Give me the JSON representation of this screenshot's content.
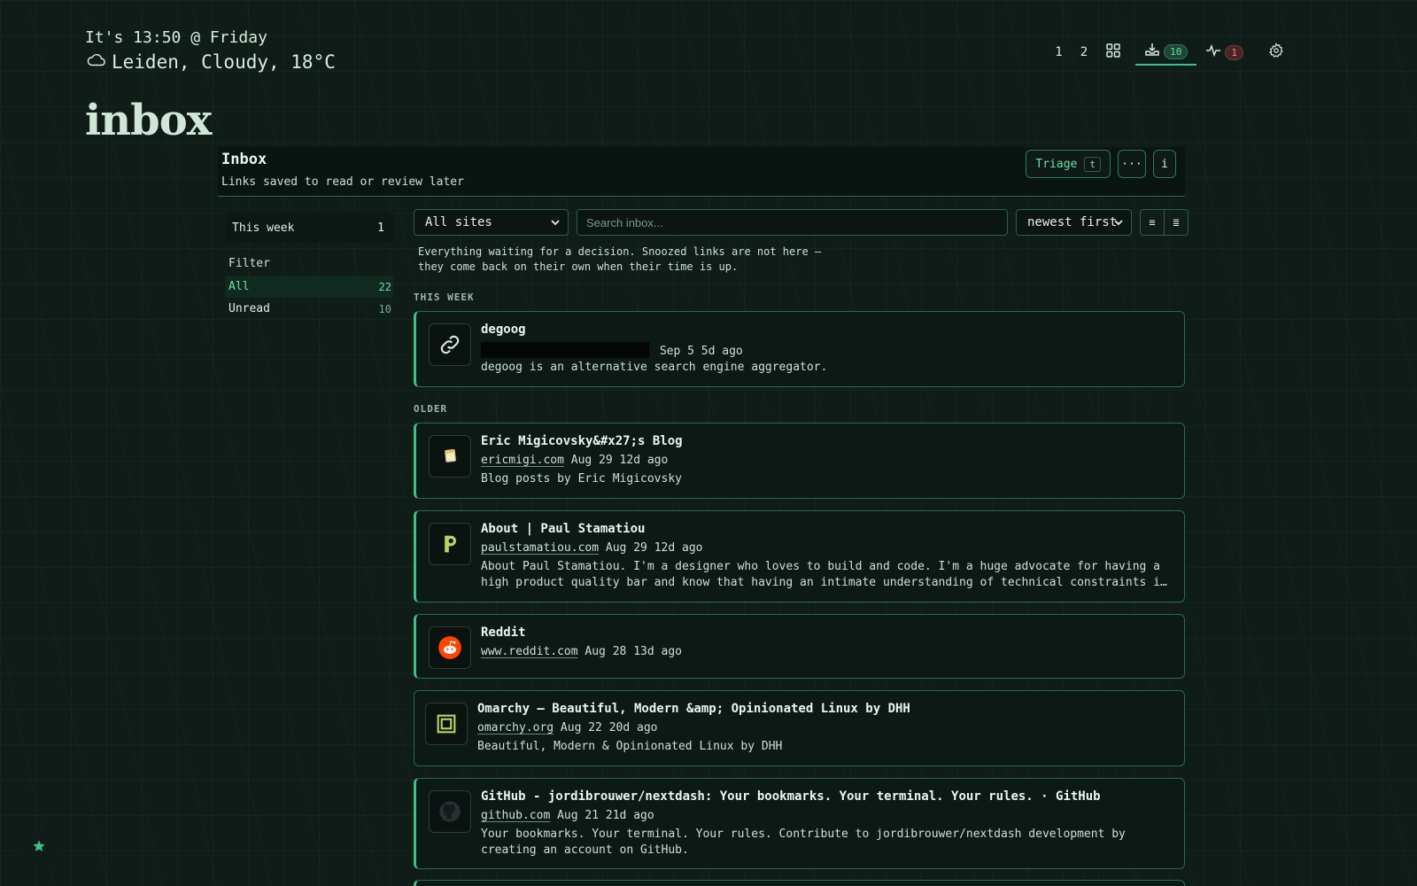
{
  "header": {
    "clock": "It's 13:50 @ Friday",
    "weather": "Leiden, Cloudy, 18°C",
    "weather_icon": "cloud-icon",
    "page_title": "inbox"
  },
  "topnav": {
    "tab1": "1",
    "tab2": "2",
    "grid_icon": "grid-icon",
    "inbox_icon": "inbox-tray-icon",
    "inbox_count": "10",
    "activity_icon": "activity-pulse-icon",
    "activity_count": "1",
    "settings_icon": "gear-icon"
  },
  "panel": {
    "title": "Inbox",
    "subtitle": "Links saved to read or review later",
    "triage_label": "Triage",
    "triage_shortcut": "t",
    "more_label": "···",
    "info_label": "i"
  },
  "sidebar": {
    "week_label": "This week",
    "week_count": "1",
    "filter_label": "Filter",
    "filters": [
      {
        "label": "All",
        "count": "22",
        "active": true
      },
      {
        "label": "Unread",
        "count": "10",
        "active": false
      }
    ]
  },
  "controls": {
    "sites_value": "All sites",
    "search_placeholder": "Search inbox...",
    "sort_value": "newest first",
    "view_list_icon": "≡",
    "view_compact_icon": "≣"
  },
  "description": "Everything waiting for a decision. Snoozed links are not here — they come back on their own when their time is up.",
  "sections": {
    "this_week": "THIS WEEK",
    "older": "OLDER"
  },
  "items": [
    {
      "title": "degoog",
      "domain": "",
      "date": "Sep 5",
      "ago": "5d ago",
      "body": "degoog is an alternative search engine aggregator.",
      "icon": "link-icon"
    },
    {
      "title": "Eric Migicovsky&#x27;s Blog",
      "domain": "ericmigi.com",
      "date": "Aug 29",
      "ago": "12d ago",
      "body": "Blog posts by Eric Migicovsky",
      "icon": "note-icon"
    },
    {
      "title": "About | Paul Stamatiou",
      "domain": "paulstamatiou.com",
      "date": "Aug 29",
      "ago": "12d ago",
      "body": "About Paul Stamatiou. I'm a designer who loves to build and code. I'm a huge advocate for having a high product quality bar and know that having an intimate understanding of technical constraints is a…",
      "icon": "p-logo-icon"
    },
    {
      "title": "Reddit",
      "domain": "www.reddit.com",
      "date": "Aug 28",
      "ago": "13d ago",
      "body": "",
      "icon": "reddit-icon"
    },
    {
      "title": "Omarchy — Beautiful, Modern &amp; Opinionated Linux by DHH",
      "domain": "omarchy.org",
      "date": "Aug 22",
      "ago": "20d ago",
      "body": "Beautiful, Modern & Opinionated Linux by DHH",
      "icon": "omarchy-icon"
    },
    {
      "title": "GitHub - jordibrouwer/nextdash: Your bookmarks. Your terminal. Your rules. · GitHub",
      "domain": "github.com",
      "date": "Aug 21",
      "ago": "21d ago",
      "body": "Your bookmarks. Your terminal. Your rules. Contribute to jordibrouwer/nextdash development by creating an account on GitHub.",
      "icon": "github-icon"
    }
  ],
  "fab_icon": "star-icon",
  "colors": {
    "accent": "#3fc088",
    "background": "#0f1c17",
    "badge_red": "#ee8a8a"
  }
}
